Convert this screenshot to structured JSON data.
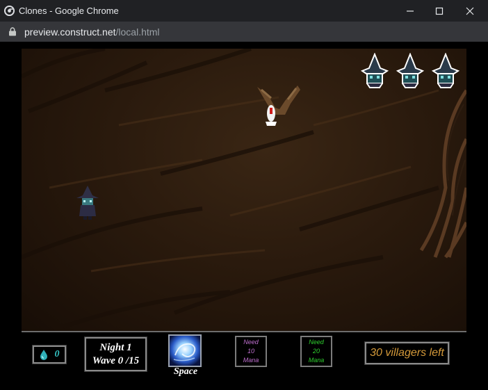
{
  "window": {
    "title": "Clones - Google Chrome",
    "icon": "chrome-logo-icon",
    "controls": [
      "minimize-icon",
      "maximize-icon",
      "close-icon"
    ]
  },
  "address_bar": {
    "host": "preview.construct.net",
    "path": "/local.html",
    "icon": "lock-icon"
  },
  "game": {
    "lives": {
      "count": 3,
      "icon": "witch-life-icon"
    },
    "sprites": [
      "bird-enemy-icon",
      "player-witch-icon"
    ],
    "hud": {
      "mana_value": "0",
      "mana_icon": "mana-drop-icon",
      "night_label": "Night 1",
      "wave_label": "Wave 0 /15",
      "space_skill_label": "Space",
      "skill2": {
        "line1": "Need",
        "line2": "10",
        "line3": "Mana"
      },
      "skill3": {
        "line1": "Need",
        "line2": "20",
        "line3": "Mana"
      },
      "villagers_text": "30 villagers left"
    },
    "colors": {
      "mana": "#34c3c3",
      "skill2_text": "#c070d0",
      "skill3_text": "#2fd02f",
      "villagers_text": "#d59a3a",
      "ground": "#2a1a0d"
    }
  }
}
